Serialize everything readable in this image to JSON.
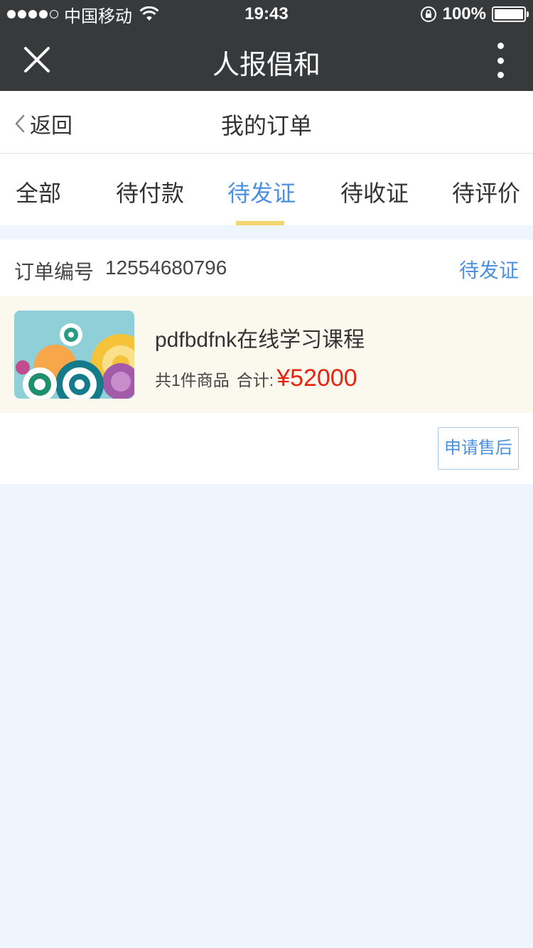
{
  "status_bar": {
    "signal_dots": 5,
    "signal_filled": 4,
    "carrier": "中国移动",
    "time": "19:43",
    "battery_text": "100%",
    "battery_level": 1.0
  },
  "nav": {
    "title": "人报倡和",
    "close_icon": "close-icon",
    "more_icon": "more-vertical-icon"
  },
  "subheader": {
    "back_label": "返回",
    "title": "我的订单"
  },
  "tabs": [
    {
      "label": "全部",
      "active": false
    },
    {
      "label": "待付款",
      "active": false
    },
    {
      "label": "待发证",
      "active": true
    },
    {
      "label": "待收证",
      "active": false
    },
    {
      "label": "待评价",
      "active": false
    }
  ],
  "order": {
    "number_label": "订单编号",
    "number": "12554680796",
    "status": "待发证",
    "item": {
      "name": "pdfbdfnk在线学习课程",
      "count_text": "共1件商品",
      "total_label": "合计:",
      "price": "¥52000"
    },
    "after_sale_button": "申请售后"
  },
  "colors": {
    "accent": "#4c90e0",
    "price": "#e8230f",
    "tab_indicator": "#f3d36b",
    "nav_bg": "#38393b",
    "page_bg": "#eef5fd"
  }
}
